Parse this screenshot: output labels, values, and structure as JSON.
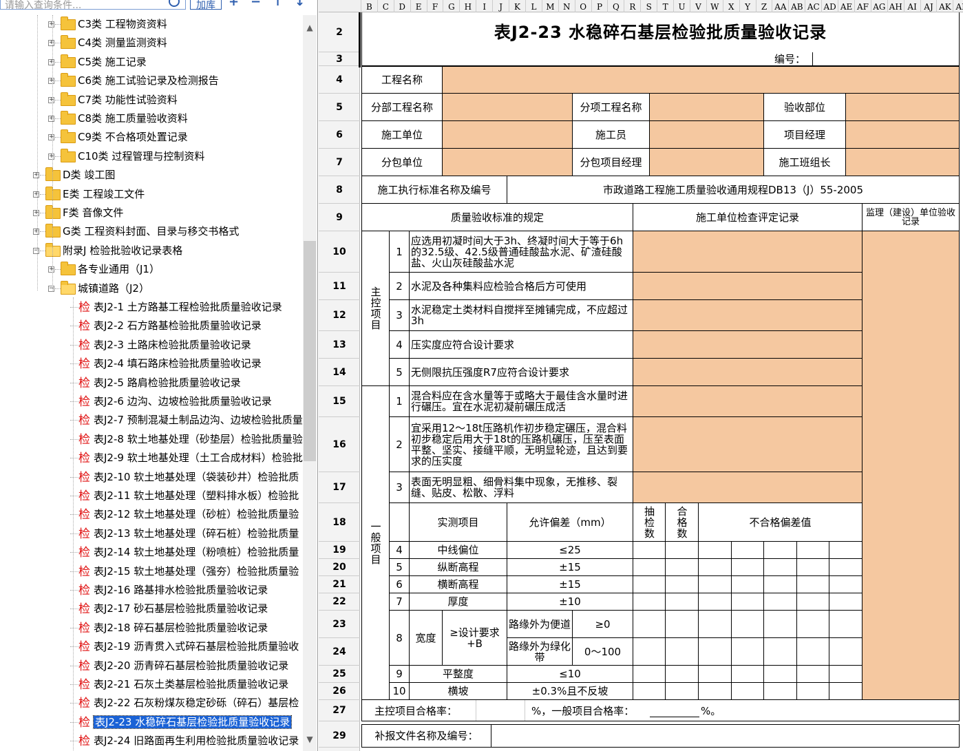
{
  "search": {
    "placeholder": "请输入查询条件..."
  },
  "toolbar": {
    "add_label": "加库",
    "plus": "+",
    "minus": "−",
    "up": "↑",
    "down": "↓"
  },
  "tree": [
    {
      "indent": 2,
      "folder": true,
      "label": "C3类 工程物资资料"
    },
    {
      "indent": 2,
      "folder": true,
      "label": "C4类 测量监测资料"
    },
    {
      "indent": 2,
      "folder": true,
      "label": "C5类 施工记录"
    },
    {
      "indent": 2,
      "folder": true,
      "label": "C6类 施工试验记录及检测报告"
    },
    {
      "indent": 2,
      "folder": true,
      "label": "C7类 功能性试验资料"
    },
    {
      "indent": 2,
      "folder": true,
      "label": "C8类 施工质量验收资料"
    },
    {
      "indent": 2,
      "folder": true,
      "label": "C9类 不合格项处置记录"
    },
    {
      "indent": 2,
      "folder": true,
      "label": "C10类 过程管理与控制资料"
    },
    {
      "indent": 1,
      "folder": true,
      "label": "D类 竣工图"
    },
    {
      "indent": 1,
      "folder": true,
      "label": "E类 工程竣工文件"
    },
    {
      "indent": 1,
      "folder": true,
      "label": "F类 音像文件"
    },
    {
      "indent": 1,
      "folder": true,
      "label": "G类 工程资料封面、目录与移交书格式"
    },
    {
      "indent": 1,
      "folder": true,
      "open": true,
      "label": "附录J 检验批验收记录表格"
    },
    {
      "indent": 2,
      "folder": true,
      "label": "各专业通用（J1）"
    },
    {
      "indent": 2,
      "folder": true,
      "open": true,
      "label": "城镇道路（J2）"
    },
    {
      "indent": 3,
      "label": "表J2-1 土方路基工程检验批质量验收记录"
    },
    {
      "indent": 3,
      "label": "表J2-2 石方路基检验批质量验收记录"
    },
    {
      "indent": 3,
      "label": "表J2-3 土路床检验批质量验收记录"
    },
    {
      "indent": 3,
      "label": "表J2-4 填石路床检验批质量验收记录"
    },
    {
      "indent": 3,
      "label": "表J2-5 路肩检验批质量验收记录"
    },
    {
      "indent": 3,
      "label": "表J2-6 边沟、边坡检验批质量验收记录"
    },
    {
      "indent": 3,
      "label": "表J2-7 预制混凝土制品边沟、边坡检验批质量"
    },
    {
      "indent": 3,
      "label": "表J2-8 软土地基处理（砂垫层）检验批质量验"
    },
    {
      "indent": 3,
      "label": "表J2-9 软土地基处理（土工合成材料）检验批"
    },
    {
      "indent": 3,
      "label": "表J2-10 软土地基处理（袋装砂井）检验批质"
    },
    {
      "indent": 3,
      "label": "表J2-11 软土地基处理（塑料排水板）检验批"
    },
    {
      "indent": 3,
      "label": "表J2-12 软土地基处理（砂桩）检验批质量验"
    },
    {
      "indent": 3,
      "label": "表J2-13 软土地基处理（碎石桩）检验批质量"
    },
    {
      "indent": 3,
      "label": "表J2-14 软土地基处理（粉喷桩）检验批质量"
    },
    {
      "indent": 3,
      "label": "表J2-15 软土地基处理（强夯）检验批质量验"
    },
    {
      "indent": 3,
      "label": "表J2-16 路基排水检验批质量验收记录"
    },
    {
      "indent": 3,
      "label": "表J2-17 砂石基层检验批质量验收记录"
    },
    {
      "indent": 3,
      "label": "表J2-18 碎石基层检验批质量验收记录"
    },
    {
      "indent": 3,
      "label": "表J2-19 沥青贯入式碎石基层检验批质量验收"
    },
    {
      "indent": 3,
      "label": "表J2-20 沥青碎石基层检验批质量验收记录"
    },
    {
      "indent": 3,
      "label": "表J2-21 石灰土类基层检验批质量验收记录"
    },
    {
      "indent": 3,
      "label": "表J2-22 石灰粉煤灰稳定砂砾（碎石）基层检"
    },
    {
      "indent": 3,
      "selected": true,
      "label": "表J2-23 水稳碎石基层检验批质量验收记录"
    },
    {
      "indent": 3,
      "label": "表J2-24 旧路面再生利用检验批质量验收记录"
    }
  ],
  "check_glyph": "检",
  "columns": [
    "B",
    "C",
    "D",
    "E",
    "F",
    "G",
    "H",
    "I",
    "J",
    "K",
    "L",
    "M",
    "N",
    "O",
    "P",
    "Q",
    "R",
    "S",
    "T",
    "U",
    "V",
    "W",
    "X",
    "Y",
    "Z",
    "AA",
    "AB",
    "AC",
    "AD",
    "AE",
    "AF",
    "AG",
    "AH",
    "AI",
    "AJ",
    "AK",
    "AL"
  ],
  "rows": [
    "2",
    "3",
    "4",
    "5",
    "6",
    "7",
    "8",
    "9",
    "10",
    "11",
    "12",
    "13",
    "14",
    "15",
    "16",
    "17",
    "18",
    "19",
    "20",
    "21",
    "22",
    "23",
    "24",
    "25",
    "26",
    "27",
    "29"
  ],
  "form": {
    "title": "表J2-23 水稳碎石基层检验批质量验收记录",
    "serial_label": "编号：",
    "project_name": "工程名称",
    "sub_project": "分部工程名称",
    "item_project": "分项工程名称",
    "accept_part": "验收部位",
    "constructor": "施工单位",
    "worker": "施工员",
    "pm": "项目经理",
    "subcontractor": "分包单位",
    "sub_pm": "分包项目经理",
    "team_leader": "施工班组长",
    "std_label": "施工执行标准名称及编号",
    "std_value": "市政道路工程施工质量验收通用规程DB13（J）55-2005",
    "rule_header": "质量验收标准的规定",
    "check_header": "施工单位检查评定记录",
    "supervisor_header": "监理（建设）单位验收记录",
    "main_group": "主控项目",
    "general_group": "一般项目",
    "main_items": [
      {
        "no": "1",
        "text": "应选用初凝时间大于3h、终凝时间大于等于6h的32.5级、42.5级普通硅酸盐水泥、矿渣硅酸盐、火山灰硅酸盐水泥"
      },
      {
        "no": "2",
        "text": "水泥及各种集料应检验合格后方可使用"
      },
      {
        "no": "3",
        "text": "水泥稳定土类材料自搅拌至摊铺完成，不应超过3h"
      },
      {
        "no": "4",
        "text": "压实度应符合设计要求"
      },
      {
        "no": "5",
        "text": "无侧限抗压强度R7应符合设计要求"
      }
    ],
    "general_items": [
      {
        "no": "1",
        "text": "混合料应在含水量等于或略大于最佳含水量时进行碾压。宜在水泥初凝前碾压成活"
      },
      {
        "no": "2",
        "text": "宜采用12～18t压路机作初步稳定碾压，混合料初步稳定后用大于18t的压路机碾压，压至表面平整、坚实、接缝平顺，无明显轮迹，且达到要求的压实度"
      },
      {
        "no": "3",
        "text": "表面无明显粗、细骨料集中现象，无推移、裂缝、贴皮、松散、浮料"
      }
    ],
    "measure_header": "实测项目",
    "tolerance_header": "允许偏差（mm）",
    "sample_header": "抽检数",
    "pass_header": "合格数",
    "fail_header": "不合格偏差值",
    "measures": [
      {
        "no": "4",
        "name": "中线偏位",
        "tol": "≤25"
      },
      {
        "no": "5",
        "name": "纵断高程",
        "tol": "±15"
      },
      {
        "no": "6",
        "name": "横断高程",
        "tol": "±15"
      },
      {
        "no": "7",
        "name": "厚度",
        "tol": "±10"
      }
    ],
    "width_no": "8",
    "width_name": "宽度",
    "width_req": "≥设计要求+B",
    "width_sub": [
      {
        "name": "路缘外为便道",
        "tol": "≥0"
      },
      {
        "name": "路缘外为绿化带",
        "tol": "0～100"
      }
    ],
    "measures2": [
      {
        "no": "9",
        "name": "平整度",
        "tol": "≤10"
      },
      {
        "no": "10",
        "name": "横坡",
        "tol": "±0.3%且不反坡"
      }
    ],
    "rate_main": "主控项目合格率：",
    "rate_mid": "%，一般项目合格率：",
    "rate_end": "%。",
    "supp_label": "补报文件名称及编号："
  }
}
